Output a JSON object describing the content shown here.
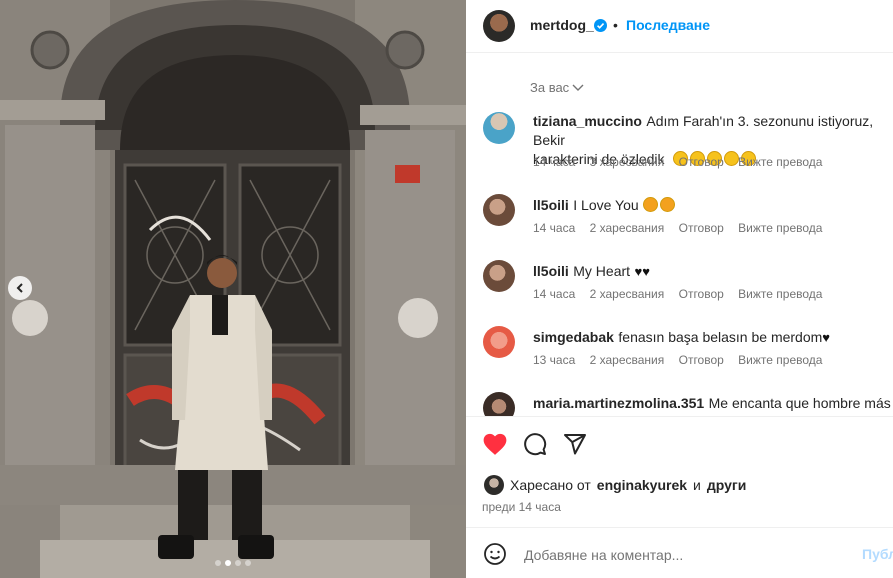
{
  "post": {
    "author": "mertdog_",
    "follow_label": "Последване",
    "separator": "•",
    "sort_label": "За вас",
    "liked_by_prefix": "Харесано от",
    "liked_by_user": "enginakyurek",
    "liked_by_and": "и",
    "liked_by_others": "други",
    "time_ago": "преди 14 часа",
    "comment_placeholder": "Добавяне на коментар...",
    "post_button": "Публ",
    "carousel_dots": 4,
    "active_dot": 2
  },
  "colors": {
    "accent": "#0095f6",
    "like_red": "#ff3040",
    "text": "#262626",
    "muted": "#737373"
  },
  "comments": [
    {
      "user": "tiziana_muccino",
      "text_line1": "Adım Farah'ın 3. sezonunu istiyoruz, Bekir",
      "text_line2": "karakterini de özledik",
      "time": "14 часа",
      "likes": "3 харесвания",
      "reply": "Отговор",
      "translate": "Вижте превода"
    },
    {
      "user": "ll5oili",
      "text_line1": "I Love You",
      "time": "14 часа",
      "likes": "2 харесвания",
      "reply": "Отговор",
      "translate": "Вижте превода"
    },
    {
      "user": "ll5oili",
      "text_line1": "My Heart",
      "time": "14 часа",
      "likes": "2 харесвания",
      "reply": "Отговор",
      "translate": "Вижте превода"
    },
    {
      "user": "simgedabak",
      "text_line1": "fenasın başa belasın be merdom",
      "time": "13 часа",
      "likes": "2 харесвания",
      "reply": "Отговор",
      "translate": "Вижте превода"
    },
    {
      "user": "maria.martinezmolina.351",
      "text_line1": "Me encanta que hombre más"
    }
  ],
  "icons": [
    "verified-badge-icon",
    "chevron-down-icon",
    "heart-icon",
    "comment-icon",
    "share-icon",
    "emoji-icon",
    "carousel-prev-icon"
  ]
}
